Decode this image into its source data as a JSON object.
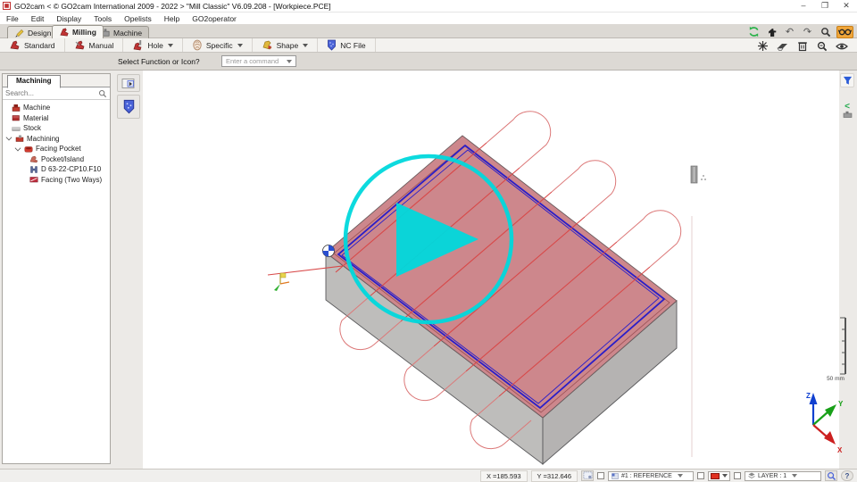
{
  "window": {
    "title": "GO2cam < © GO2cam International 2009 - 2022 >    \"Mill Classic\"   V6.09.208 - [Workpiece.PCE]",
    "minimize": "–",
    "maximize": "❐",
    "close": "✕"
  },
  "menu": {
    "items": [
      "File",
      "Edit",
      "Display",
      "Tools",
      "Opelists",
      "Help",
      "GO2operator"
    ]
  },
  "ribbon": {
    "tabs": [
      {
        "label": "Design"
      },
      {
        "label": "Milling"
      },
      {
        "label": "Machine"
      }
    ],
    "active_tab": "Milling",
    "buttons": [
      {
        "label": "Standard"
      },
      {
        "label": "Manual"
      },
      {
        "label": "Hole",
        "dropdown": true
      },
      {
        "label": "Specific",
        "dropdown": true
      },
      {
        "label": "Shape",
        "dropdown": true
      },
      {
        "label": "NC File"
      }
    ]
  },
  "command_bar": {
    "label": "Select Function or Icon?",
    "value": "Enter a command"
  },
  "left_panel": {
    "tab": "Machining",
    "search_placeholder": "Search...",
    "tree": [
      {
        "label": "Machine",
        "icon": "machine-icon",
        "depth": 0
      },
      {
        "label": "Material",
        "icon": "material-icon",
        "depth": 0
      },
      {
        "label": "Stock",
        "icon": "stock-icon",
        "depth": 0
      },
      {
        "label": "Machining",
        "icon": "machining-icon",
        "depth": 0,
        "expanded": true
      },
      {
        "label": "Facing Pocket",
        "icon": "facing-pocket-icon",
        "depth": 1,
        "expanded": true
      },
      {
        "label": "Pocket/Island",
        "icon": "pocket-island-icon",
        "depth": 2
      },
      {
        "label": "D 63-22-CP10.F10",
        "icon": "tool-icon",
        "depth": 2
      },
      {
        "label": "Facing (Two Ways)",
        "icon": "facing-icon",
        "depth": 2
      }
    ]
  },
  "viewport": {
    "scale_label": "50 mm",
    "axis_x": "X",
    "axis_y": "Y",
    "axis_z": "Z",
    "colors": {
      "face_top": "#c97d82",
      "stock_side_left": "#b3b1af",
      "stock_side_right": "#a8a6a4",
      "toolpath": "#d84848",
      "lead_loop": "#dc7878",
      "pocket_outline": "#2a1ec8",
      "overlay_cyan": "#00d8dc",
      "axis_x_color": "#cc2020",
      "axis_y_color": "#18a018",
      "axis_z_color": "#1040d0"
    }
  },
  "status_bar": {
    "x_coord": "X =185.593",
    "y_coord": "Y =312.646",
    "reference": "#1 : REFERENCE",
    "layer": "LAYER : 1",
    "help": "?"
  }
}
